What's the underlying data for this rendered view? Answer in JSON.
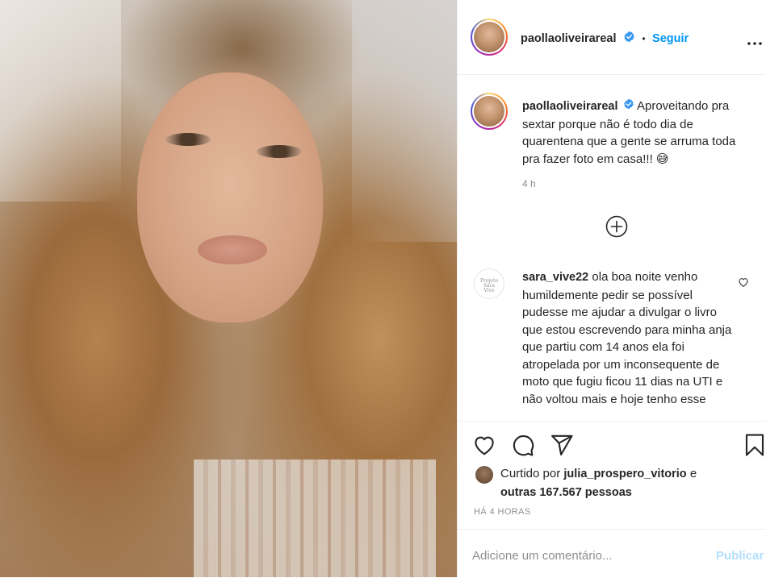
{
  "post": {
    "username": "paollaoliveirareal",
    "separator": "•",
    "follow_label": "Seguir",
    "caption": "Aproveitando pra sextar porque não é todo dia de quarentena que a gente se arruma toda pra fazer foto em casa!!! 😅",
    "time_short": "4 h"
  },
  "comment": {
    "username": "sara_vive22",
    "text": "ola boa noite venho humildemente pedir se possível pudesse me ajudar a divulgar o livro que estou escrevendo para minha anja que partiu com 14 anos ela foi atropelada por um inconsequente de moto que fugiu ficou 11 dias na UTI e não voltou mais e hoje tenho esse",
    "avatar_text": "Projeto Sara Vive"
  },
  "likes": {
    "prefix": "Curtido por",
    "user": "julia_prospero_vitorio",
    "conj": "e",
    "others": "outras 167.567 pessoas"
  },
  "post_time": "HÁ 4 HORAS",
  "comment_box": {
    "placeholder": "Adicione um comentário...",
    "publish_label": "Publicar"
  },
  "icons": {
    "verified": "verified-badge-icon",
    "more": "more-options-icon",
    "load_more": "plus-circle-icon",
    "like": "heart-icon",
    "comment": "comment-bubble-icon",
    "share": "paper-plane-icon",
    "save": "bookmark-icon"
  },
  "colors": {
    "link_blue": "#0095f6",
    "verified_blue": "#3897f0",
    "muted": "#8e8e8e",
    "publish_disabled": "#b2dffc"
  }
}
